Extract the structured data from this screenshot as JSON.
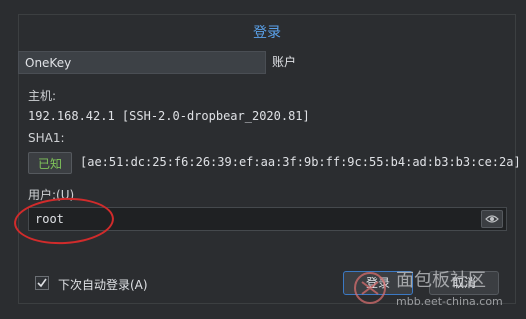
{
  "dialog": {
    "title": "登录"
  },
  "tabs": [
    {
      "label": "OneKey"
    },
    {
      "label": "账户"
    }
  ],
  "host": {
    "label": "主机:",
    "value": "192.168.42.1 [SSH-2.0-dropbear_2020.81]"
  },
  "sha1": {
    "label": "SHA1:",
    "known_button": "已知",
    "fingerprint": "[ae:51:dc:25:f6:26:39:ef:aa:3f:9b:ff:9c:55:b4:ad:b3:b3:ce:2a]"
  },
  "user": {
    "label": "用户:(U)",
    "value": "root"
  },
  "auto_login": {
    "label": "下次自动登录(A)",
    "checked": true
  },
  "buttons": {
    "login": "登录",
    "cancel": "取消"
  },
  "watermark": {
    "line1": "面包板社区",
    "line2": "mbb.eet-china.com"
  },
  "colors": {
    "accent": "#5aa0e8",
    "known": "#7fc35a",
    "annotation": "#d12b2b"
  },
  "icons": {
    "eye": "eye-icon",
    "check": "check-icon"
  }
}
